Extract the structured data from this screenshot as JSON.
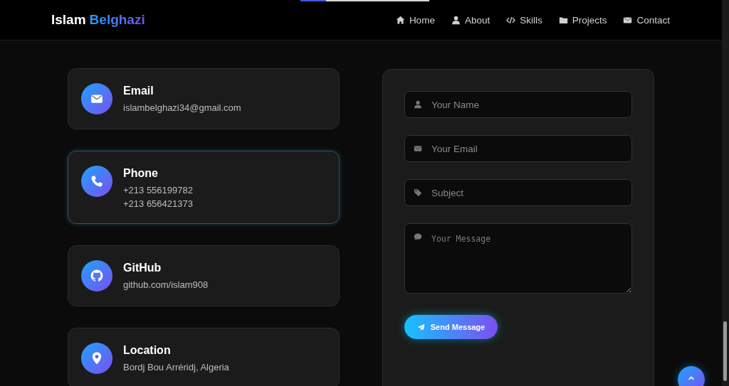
{
  "header": {
    "brand": [
      {
        "text": "Islam",
        "kind": "plain"
      },
      {
        "text": "Belghazi",
        "kind": "gradient"
      }
    ],
    "scroll_progress": {
      "level": 0.2
    },
    "nav": [
      {
        "label": "Home"
      },
      {
        "label": "About"
      },
      {
        "label": "Skills"
      },
      {
        "label": "Projects"
      },
      {
        "label": "Contact"
      }
    ]
  },
  "contact_cards": [
    {
      "title": "Email",
      "lines": [
        "islambelghazi34@gmail.com"
      ],
      "highlighted": false
    },
    {
      "title": "Phone",
      "lines": [
        "+213 556199782",
        "+213 656421373"
      ],
      "highlighted": true
    },
    {
      "title": "GitHub",
      "lines": [
        "github.com/islam908"
      ],
      "highlighted": false
    },
    {
      "title": "Location",
      "lines": [
        "Bordj Bou Arréridj, Algeria"
      ],
      "highlighted": false
    }
  ],
  "form": {
    "fields": [
      {
        "kind": "input",
        "placeholder": "Your Name"
      },
      {
        "kind": "input",
        "placeholder": "Your Email"
      },
      {
        "kind": "input",
        "placeholder": "Subject"
      },
      {
        "kind": "textarea",
        "placeholder": "Your Message"
      }
    ],
    "submit": {
      "label": "Send Message"
    }
  }
}
